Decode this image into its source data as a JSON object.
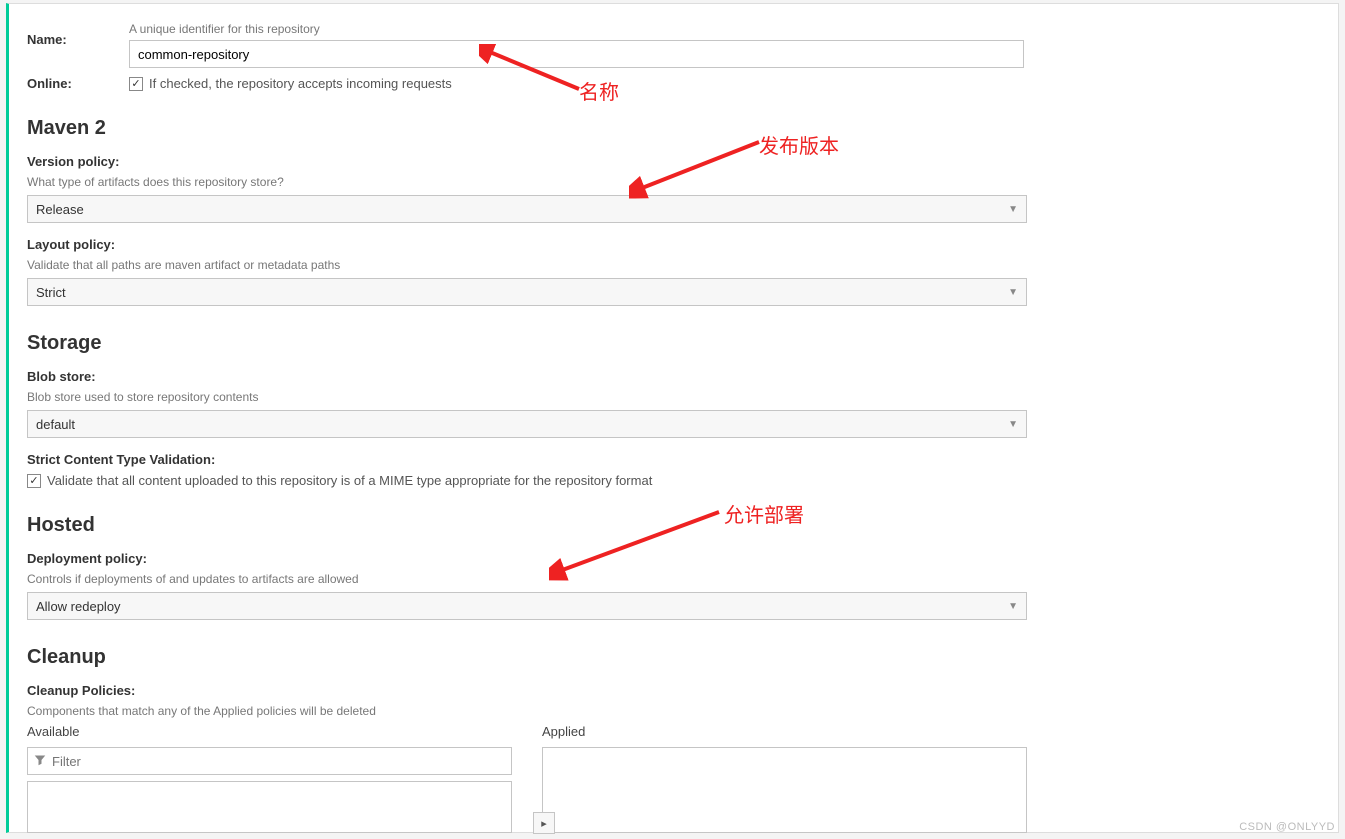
{
  "header": {
    "name_label": "Name:",
    "name_hint": "A unique identifier for this repository",
    "name_value": "common-repository",
    "online_label": "Online:",
    "online_checkbox_text": "If checked, the repository accepts incoming requests",
    "online_checked": true
  },
  "maven": {
    "title": "Maven 2",
    "version_policy_label": "Version policy:",
    "version_policy_hint": "What type of artifacts does this repository store?",
    "version_policy_value": "Release",
    "layout_policy_label": "Layout policy:",
    "layout_policy_hint": "Validate that all paths are maven artifact or metadata paths",
    "layout_policy_value": "Strict"
  },
  "storage": {
    "title": "Storage",
    "blob_store_label": "Blob store:",
    "blob_store_hint": "Blob store used to store repository contents",
    "blob_store_value": "default",
    "strict_label": "Strict Content Type Validation:",
    "strict_checkbox_text": "Validate that all content uploaded to this repository is of a MIME type appropriate for the repository format",
    "strict_checked": true
  },
  "hosted": {
    "title": "Hosted",
    "deploy_label": "Deployment policy:",
    "deploy_hint": "Controls if deployments of and updates to artifacts are allowed",
    "deploy_value": "Allow redeploy"
  },
  "cleanup": {
    "title": "Cleanup",
    "policies_label": "Cleanup Policies:",
    "policies_hint": "Components that match any of the Applied policies will be deleted",
    "available_label": "Available",
    "applied_label": "Applied",
    "filter_placeholder": "Filter"
  },
  "annotations": {
    "name": "名称",
    "version": "发布版本",
    "deploy": "允许部署"
  },
  "watermark": "CSDN @ONLYYD"
}
